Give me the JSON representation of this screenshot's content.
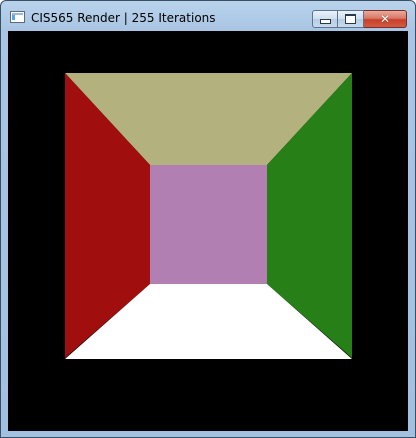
{
  "window": {
    "title": "CIS565 Render | 255 Iterations",
    "controls": {
      "minimize_icon": "minimize-icon",
      "maximize_icon": "maximize-icon",
      "close_icon": "close-icon",
      "close_glyph": "✕"
    }
  },
  "render": {
    "background": "#000000",
    "surfaces": {
      "ceiling": "#b3b27f",
      "left_wall": "#a00f0d",
      "right_wall": "#268017",
      "back_wall": "#b27fb3",
      "floor": "#ffffff"
    }
  }
}
